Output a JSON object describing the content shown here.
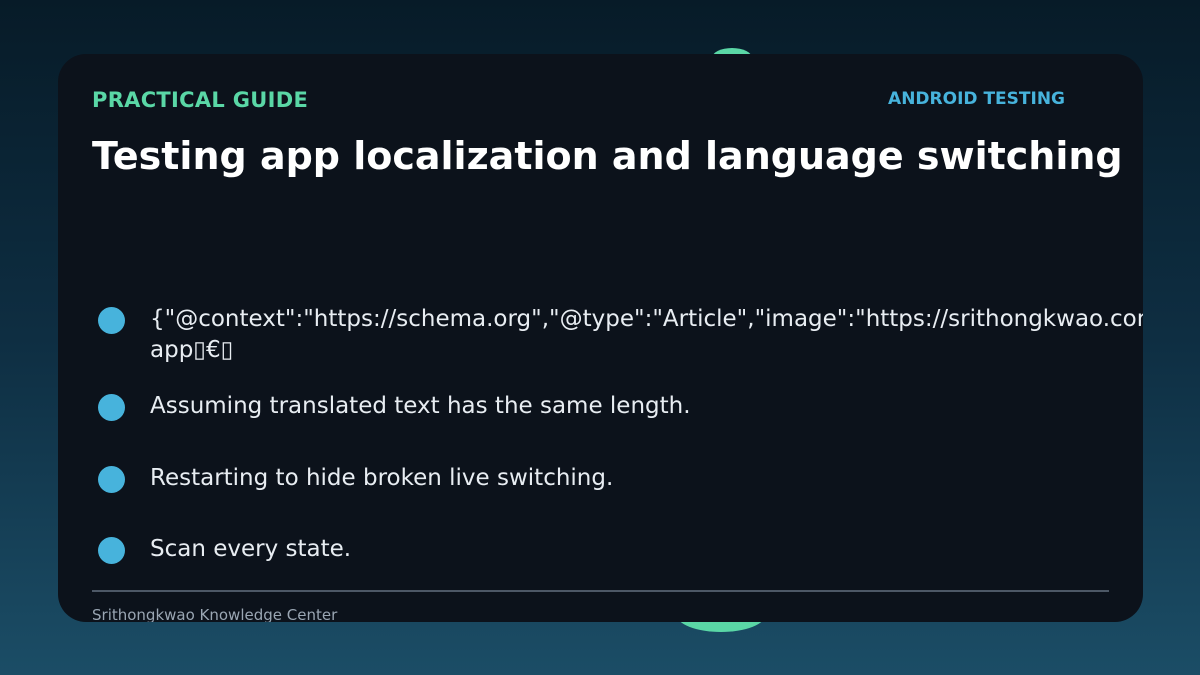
{
  "card": {
    "eyebrow": "PRACTICAL GUIDE",
    "tag": "ANDROID TESTING",
    "title": "Testing app localization and language switching",
    "items": [
      {
        "text": "{\"@context\":\"https://schema.org\",\"@type\":\"Article\",\"image\":\"https://srithongkwao.com/g\napp▯€▯"
      },
      {
        "text": "Assuming translated text has the same length."
      },
      {
        "text": "Restarting to hide broken live switching."
      },
      {
        "text": "Scan every state."
      }
    ],
    "footer": "Srithongkwao Knowledge Center"
  },
  "colors": {
    "accent_green": "#5ad7a6",
    "accent_blue": "#47b3dc",
    "card_bg": "#0c121b"
  }
}
